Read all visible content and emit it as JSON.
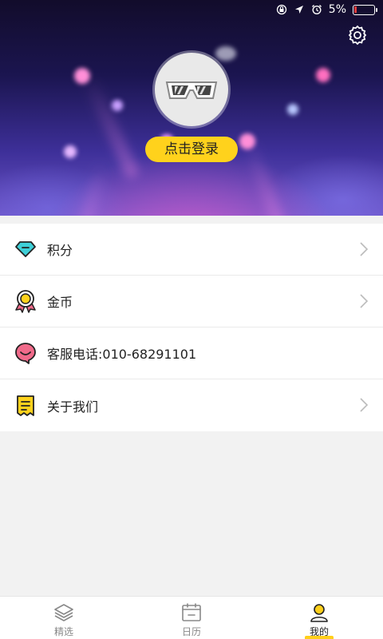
{
  "status_bar": {
    "battery_percent": "5%",
    "battery_level": 0.05,
    "battery_color": "#e43c3c",
    "icons": [
      "rotation-lock-icon",
      "location-arrow-icon",
      "alarm-icon"
    ]
  },
  "header": {
    "settings_icon": "gear-icon",
    "avatar_icon": "sunglasses-icon",
    "login_label": "点击登录",
    "accent": "#ffd21c"
  },
  "menu": {
    "items": [
      {
        "label": "积分",
        "icon": "diamond-icon",
        "chevron": true
      },
      {
        "label": "金币",
        "icon": "medal-icon",
        "chevron": true
      },
      {
        "label": "客服电话:010-68291101",
        "icon": "chat-bubble-icon",
        "chevron": false
      },
      {
        "label": "关于我们",
        "icon": "receipt-icon",
        "chevron": true
      }
    ]
  },
  "tabbar": {
    "tabs": [
      {
        "label": "精选",
        "icon": "layers-icon",
        "active": false
      },
      {
        "label": "日历",
        "icon": "calendar-icon",
        "active": false
      },
      {
        "label": "我的",
        "icon": "user-icon",
        "active": true
      }
    ]
  }
}
